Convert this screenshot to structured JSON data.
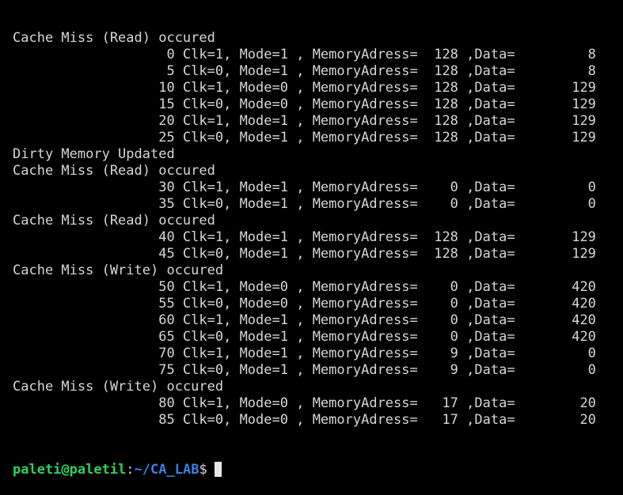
{
  "terminal": {
    "lines": [
      "Cache Miss (Read) occured",
      "                   0 Clk=1, Mode=1 , MemoryAdress=  128 ,Data=         8",
      "                   5 Clk=0, Mode=1 , MemoryAdress=  128 ,Data=         8",
      "                  10 Clk=1, Mode=0 , MemoryAdress=  128 ,Data=       129",
      "                  15 Clk=0, Mode=0 , MemoryAdress=  128 ,Data=       129",
      "                  20 Clk=1, Mode=1 , MemoryAdress=  128 ,Data=       129",
      "                  25 Clk=0, Mode=1 , MemoryAdress=  128 ,Data=       129",
      "Dirty Memory Updated",
      "Cache Miss (Read) occured",
      "                  30 Clk=1, Mode=1 , MemoryAdress=    0 ,Data=         0",
      "                  35 Clk=0, Mode=1 , MemoryAdress=    0 ,Data=         0",
      "Cache Miss (Read) occured",
      "                  40 Clk=1, Mode=1 , MemoryAdress=  128 ,Data=       129",
      "                  45 Clk=0, Mode=1 , MemoryAdress=  128 ,Data=       129",
      "Cache Miss (Write) occured",
      "                  50 Clk=1, Mode=0 , MemoryAdress=    0 ,Data=       420",
      "                  55 Clk=0, Mode=0 , MemoryAdress=    0 ,Data=       420",
      "                  60 Clk=1, Mode=1 , MemoryAdress=    0 ,Data=       420",
      "                  65 Clk=0, Mode=1 , MemoryAdress=    0 ,Data=       420",
      "                  70 Clk=1, Mode=1 , MemoryAdress=    9 ,Data=         0",
      "                  75 Clk=0, Mode=1 , MemoryAdress=    9 ,Data=         0",
      "Cache Miss (Write) occured",
      "                  80 Clk=1, Mode=0 , MemoryAdress=   17 ,Data=        20",
      "                  85 Clk=0, Mode=0 , MemoryAdress=   17 ,Data=        20"
    ],
    "prompt": {
      "user_host": "paleti@paletil",
      "separator": ":",
      "path": "~/CA_LAB",
      "symbol": "$"
    },
    "colors": {
      "background": "#000000",
      "text": "#d6d6d6",
      "user_host": "#2fd05a",
      "path": "#3f7fe0",
      "cursor": "#e8e8e8"
    }
  }
}
